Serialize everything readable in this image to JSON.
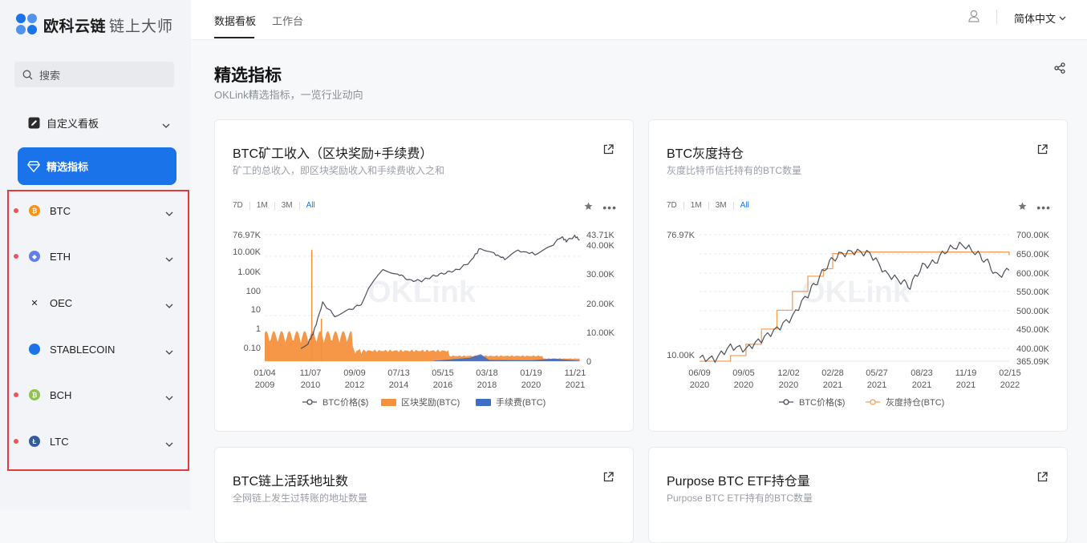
{
  "brand": {
    "name": "欧科云链",
    "sub": "链上大师"
  },
  "search": {
    "placeholder": "搜索"
  },
  "nav": {
    "custom_board": "自定义看板",
    "selected": "精选指标"
  },
  "chains": [
    {
      "label": "BTC",
      "color": "#f7931a",
      "glyph": "₿",
      "dot": true
    },
    {
      "label": "ETH",
      "color": "#627eea",
      "glyph": "◆",
      "dot": true
    },
    {
      "label": "OEC",
      "color": "#222222",
      "glyph": "✕",
      "dot": false
    },
    {
      "label": "STABLECOIN",
      "color": "#1a73e8",
      "glyph": "",
      "dot": false
    },
    {
      "label": "BCH",
      "color": "#8dc351",
      "glyph": "₿",
      "dot": true
    },
    {
      "label": "LTC",
      "color": "#345d9d",
      "glyph": "Ł",
      "dot": true
    }
  ],
  "top_tabs": {
    "dashboard": "数据看板",
    "workbench": "工作台"
  },
  "language": "简体中文",
  "page": {
    "title": "精选指标",
    "subtitle": "OKLink精选指标，一览行业动向"
  },
  "ranges": [
    "7D",
    "1M",
    "3M",
    "All"
  ],
  "active_range": "All",
  "cards": [
    {
      "title": "BTC矿工收入（区块奖励+手续费）",
      "subtitle": "矿工的总收入，即区块奖励收入和手续费收入之和"
    },
    {
      "title": "BTC灰度持仓",
      "subtitle": "灰度比特币信托持有的BTC数量"
    },
    {
      "title": "BTC链上活跃地址数",
      "subtitle": "全网链上发生过转账的地址数量"
    },
    {
      "title": "Purpose BTC ETF持仓量",
      "subtitle": "Purpose BTC ETF持有的BTC数量"
    }
  ],
  "watermark": "OKLink",
  "colors": {
    "accent": "#1a73e8",
    "price": "#4a4f5a",
    "reward": "#f5913e",
    "fee": "#3f6ec6",
    "gray_holdings": "#f5a05e"
  },
  "chart_data": [
    {
      "type": "line",
      "title": "BTC矿工收入（区块奖励+手续费）",
      "x_ticks": [
        "01/04 2009",
        "11/07 2010",
        "09/09 2012",
        "07/13 2014",
        "05/15 2016",
        "03/18 2018",
        "01/19 2020",
        "11/21 2021"
      ],
      "y_left_ticks": [
        "76.97K",
        "10.00K",
        "1.00K",
        "100",
        "10",
        "1",
        "0.10"
      ],
      "y_left_scale": "log",
      "y_right_ticks": [
        "43.71K",
        "40.00K",
        "30.00K",
        "20.00K",
        "10.00K",
        "0"
      ],
      "legend": [
        "BTC价格($)",
        "区块奖励(BTC)",
        "手续费(BTC)"
      ],
      "series": [
        {
          "name": "BTC价格($)",
          "x": [
            2010.5,
            2010.8,
            2011.0,
            2011.4,
            2011.9,
            2012.5,
            2013.0,
            2013.3,
            2013.9,
            2014.5,
            2015.0,
            2015.5,
            2016.0,
            2016.5,
            2017.0,
            2017.5,
            2017.95,
            2018.5,
            2018.95,
            2019.5,
            2020.2,
            2020.8,
            2021.3,
            2021.5,
            2021.85,
            2022.05
          ],
          "y": [
            0.05,
            0.1,
            0.3,
            15,
            3,
            6,
            13,
            100,
            900,
            600,
            250,
            240,
            430,
            650,
            950,
            2500,
            15000,
            7000,
            3800,
            10000,
            7000,
            15000,
            60000,
            34000,
            65000,
            40000
          ]
        },
        {
          "name": "区块奖励(BTC)",
          "x": [
            2009.0,
            2010.0,
            2011.0,
            2012.5,
            2012.6,
            2016.5,
            2016.6,
            2020.4,
            2020.5,
            2022.05
          ],
          "y": [
            7200,
            7200,
            7200,
            7200,
            3600,
            3600,
            1800,
            1800,
            900,
            900
          ]
        },
        {
          "name": "手续费(BTC)",
          "x": [
            2009.0,
            2016.0,
            2017.5,
            2017.95,
            2018.3,
            2020.0,
            2021.0,
            2022.05
          ],
          "y": [
            0,
            50,
            400,
            800,
            150,
            100,
            300,
            50
          ]
        }
      ]
    },
    {
      "type": "line",
      "title": "BTC灰度持仓",
      "x_ticks": [
        "06/09 2020",
        "09/05 2020",
        "12/02 2020",
        "02/28 2021",
        "05/27 2021",
        "08/23 2021",
        "11/19 2021",
        "02/15 2022"
      ],
      "y_left_ticks": [
        "76.97K",
        "10.00K"
      ],
      "y_right_ticks": [
        "700.00K",
        "650.00K",
        "600.00K",
        "550.00K",
        "500.00K",
        "450.00K",
        "400.00K",
        "365.09K"
      ],
      "legend": [
        "BTC价格($)",
        "灰度持仓(BTC)"
      ],
      "series": [
        {
          "name": "BTC价格($)",
          "x": [
            0,
            0.05,
            0.1,
            0.15,
            0.2,
            0.25,
            0.3,
            0.35,
            0.38,
            0.42,
            0.45,
            0.5,
            0.55,
            0.6,
            0.65,
            0.68,
            0.72,
            0.76,
            0.8,
            0.85,
            0.9,
            0.93,
            0.96,
            1.0
          ],
          "y": [
            9500,
            9300,
            11500,
            11000,
            13000,
            15500,
            19000,
            28000,
            35000,
            48000,
            55000,
            58000,
            56000,
            40000,
            35000,
            32000,
            45000,
            48000,
            60000,
            65000,
            55000,
            48000,
            38000,
            42000
          ]
        },
        {
          "name": "灰度持仓(BTC)",
          "x": [
            0,
            0.1,
            0.15,
            0.2,
            0.25,
            0.3,
            0.35,
            0.4,
            0.43,
            0.5,
            1.0
          ],
          "y": [
            365090,
            380000,
            410000,
            450000,
            500000,
            550000,
            590000,
            610000,
            650000,
            654000,
            645000
          ]
        }
      ]
    }
  ]
}
